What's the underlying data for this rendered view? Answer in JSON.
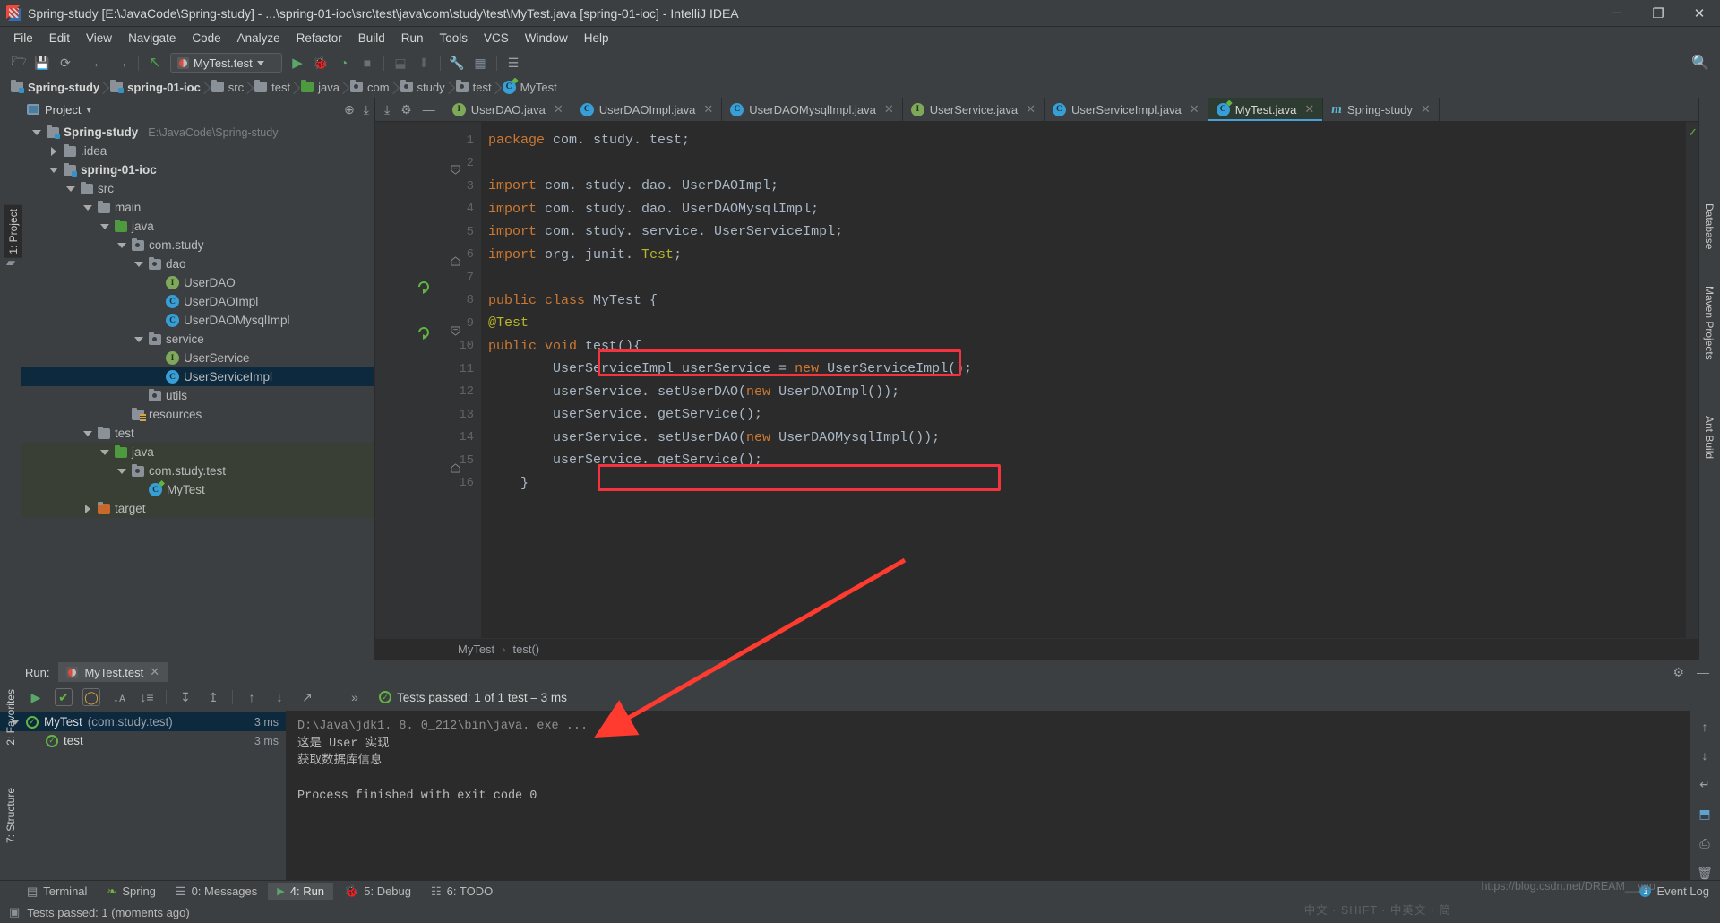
{
  "window": {
    "title": "Spring-study [E:\\JavaCode\\Spring-study] - ...\\spring-01-ioc\\src\\test\\java\\com\\study\\test\\MyTest.java [spring-01-ioc] - IntelliJ IDEA",
    "minimize": "─",
    "maximize": "❐",
    "close": "✕"
  },
  "menubar": [
    {
      "label": "File"
    },
    {
      "label": "Edit"
    },
    {
      "label": "View"
    },
    {
      "label": "Navigate"
    },
    {
      "label": "Code"
    },
    {
      "label": "Analyze"
    },
    {
      "label": "Refactor"
    },
    {
      "label": "Build"
    },
    {
      "label": "Run"
    },
    {
      "label": "Tools"
    },
    {
      "label": "VCS"
    },
    {
      "label": "Window"
    },
    {
      "label": "Help"
    }
  ],
  "toolbar": {
    "open_icon": "🗁",
    "save_icon": "💾",
    "sync_icon": "⟳",
    "back_icon": "←",
    "forward_icon": "→",
    "build_icon": "↖",
    "run_config": "MyTest.test",
    "run_icon": "▶",
    "debug_icon": "🐞",
    "coverage_icon": "◔",
    "stop_icon": "■",
    "stack_icon": "⬓",
    "profile_icon": "⬇",
    "settings_icon": "🔧",
    "project-structure_icon": "▦",
    "database_icon": "☰",
    "search_icon": "🔍"
  },
  "breadcrumb": [
    {
      "label": "Spring-study",
      "icon": "module-icon",
      "bold": true
    },
    {
      "label": "spring-01-ioc",
      "icon": "module-icon",
      "bold": true
    },
    {
      "label": "src",
      "icon": "folder-icon",
      "bold": false
    },
    {
      "label": "test",
      "icon": "folder-icon",
      "bold": false
    },
    {
      "label": "java",
      "icon": "source-folder-icon",
      "bold": false
    },
    {
      "label": "com",
      "icon": "package-icon",
      "bold": false
    },
    {
      "label": "study",
      "icon": "package-icon",
      "bold": false
    },
    {
      "label": "test",
      "icon": "package-icon",
      "bold": false
    },
    {
      "label": "MyTest",
      "icon": "test-class-icon",
      "bold": false
    }
  ],
  "left_strip": {
    "project_label": "1: Project",
    "favorites_label": "2: Favorites",
    "structure_label": "7: Structure"
  },
  "right_strip": {
    "database_label": "Database",
    "maven_label": "Maven Projects",
    "ant_label": "Ant Build"
  },
  "project_panel": {
    "title": "Project",
    "caret": "▾",
    "locate_icon": "⊕",
    "collapse_icon": "⤓",
    "settings_icon": "⚙",
    "hide_icon": "—",
    "tree": [
      {
        "label": "Spring-study",
        "path": "E:\\JavaCode\\Spring-study",
        "indent": 0,
        "twisty": "down",
        "icon": "module-icon",
        "bold": true,
        "state": "normal"
      },
      {
        "label": ".idea",
        "path": "",
        "indent": 1,
        "twisty": "right",
        "icon": "folder-icon",
        "bold": false,
        "state": "normal"
      },
      {
        "label": "spring-01-ioc",
        "path": "",
        "indent": 1,
        "twisty": "down",
        "icon": "module-icon",
        "bold": true,
        "state": "normal"
      },
      {
        "label": "src",
        "path": "",
        "indent": 2,
        "twisty": "down",
        "icon": "folder-icon",
        "bold": false,
        "state": "normal"
      },
      {
        "label": "main",
        "path": "",
        "indent": 3,
        "twisty": "down",
        "icon": "folder-icon",
        "bold": false,
        "state": "normal"
      },
      {
        "label": "java",
        "path": "",
        "indent": 4,
        "twisty": "down",
        "icon": "source-folder-icon",
        "bold": false,
        "state": "normal"
      },
      {
        "label": "com.study",
        "path": "",
        "indent": 5,
        "twisty": "down",
        "icon": "package-icon",
        "bold": false,
        "state": "normal"
      },
      {
        "label": "dao",
        "path": "",
        "indent": 6,
        "twisty": "down",
        "icon": "package-icon",
        "bold": false,
        "state": "normal"
      },
      {
        "label": "UserDAO",
        "path": "",
        "indent": 7,
        "twisty": "none",
        "icon": "interface-icon",
        "bold": false,
        "state": "normal"
      },
      {
        "label": "UserDAOImpl",
        "path": "",
        "indent": 7,
        "twisty": "none",
        "icon": "class-icon",
        "bold": false,
        "state": "normal"
      },
      {
        "label": "UserDAOMysqlImpl",
        "path": "",
        "indent": 7,
        "twisty": "none",
        "icon": "class-icon",
        "bold": false,
        "state": "normal"
      },
      {
        "label": "service",
        "path": "",
        "indent": 6,
        "twisty": "down",
        "icon": "package-icon",
        "bold": false,
        "state": "normal"
      },
      {
        "label": "UserService",
        "path": "",
        "indent": 7,
        "twisty": "none",
        "icon": "interface-icon",
        "bold": false,
        "state": "normal"
      },
      {
        "label": "UserServiceImpl",
        "path": "",
        "indent": 7,
        "twisty": "none",
        "icon": "class-icon",
        "bold": false,
        "state": "selected"
      },
      {
        "label": "utils",
        "path": "",
        "indent": 6,
        "twisty": "none",
        "icon": "package-icon",
        "bold": false,
        "state": "normal"
      },
      {
        "label": "resources",
        "path": "",
        "indent": 5,
        "twisty": "none",
        "icon": "resources-icon",
        "bold": false,
        "state": "normal"
      },
      {
        "label": "test",
        "path": "",
        "indent": 3,
        "twisty": "down",
        "icon": "folder-icon",
        "bold": false,
        "state": "normal"
      },
      {
        "label": "java",
        "path": "",
        "indent": 4,
        "twisty": "down",
        "icon": "test-source-folder-icon",
        "bold": false,
        "state": "green"
      },
      {
        "label": "com.study.test",
        "path": "",
        "indent": 5,
        "twisty": "down",
        "icon": "package-icon",
        "bold": false,
        "state": "green"
      },
      {
        "label": "MyTest",
        "path": "",
        "indent": 6,
        "twisty": "none",
        "icon": "test-class-icon",
        "bold": false,
        "state": "green"
      },
      {
        "label": "target",
        "path": "",
        "indent": 3,
        "twisty": "right",
        "icon": "target-folder-icon",
        "bold": false,
        "state": "green"
      }
    ]
  },
  "editor_tabs": [
    {
      "label": "UserDAO.java",
      "icon": "interface-icon",
      "close": "✕",
      "active": false
    },
    {
      "label": "UserDAOImpl.java",
      "icon": "class-icon",
      "close": "✕",
      "active": false
    },
    {
      "label": "UserDAOMysqlImpl.java",
      "icon": "class-icon",
      "close": "✕",
      "active": false
    },
    {
      "label": "UserService.java",
      "icon": "interface-icon",
      "close": "✕",
      "active": false
    },
    {
      "label": "UserServiceImpl.java",
      "icon": "class-icon",
      "close": "✕",
      "active": false
    },
    {
      "label": "MyTest.java",
      "icon": "test-class-icon",
      "close": "✕",
      "active": true
    },
    {
      "label": "Spring-study",
      "icon": "maven-icon",
      "close": "✕",
      "active": false
    }
  ],
  "editor": {
    "tab_left_icons": {
      "collapse_icon": "⤓",
      "settings_icon": "⚙",
      "hide_icon": "—"
    },
    "inspection_ok": "✓",
    "lines": [
      {
        "n": "1",
        "html": "<span class='kw'>package</span> com. study. test;"
      },
      {
        "n": "2",
        "html": ""
      },
      {
        "n": "3",
        "html": "<span class='kw'>import</span> com. study. dao. UserDAOImpl;"
      },
      {
        "n": "4",
        "html": "<span class='kw'>import</span> com. study. dao. UserDAOMysqlImpl;"
      },
      {
        "n": "5",
        "html": "<span class='kw'>import</span> com. study. service. UserServiceImpl;"
      },
      {
        "n": "6",
        "html": "<span class='kw'>import</span> org. junit. <span class='ann'>Test</span>;"
      },
      {
        "n": "7",
        "html": ""
      },
      {
        "n": "8",
        "html": "<span class='kw'>public class</span> MyTest {"
      },
      {
        "n": "9",
        "html": "    <span class='ann'>@Test</span>"
      },
      {
        "n": "10",
        "html": "    <span class='kw'>public void</span> test(){"
      },
      {
        "n": "11",
        "html": "        UserServiceImpl userService = <span class='kw'>new</span> UserServiceImpl();"
      },
      {
        "n": "12",
        "html": "        userService. setUserDAO(<span class='kw'>new</span> UserDAOImpl());"
      },
      {
        "n": "13",
        "html": "        userService. getService();"
      },
      {
        "n": "14",
        "html": "        userService. setUserDAO(<span class='kw'>new</span> UserDAOMysqlImpl());"
      },
      {
        "n": "15",
        "html": "        userService. getService();"
      },
      {
        "n": "16",
        "html": "    }"
      }
    ],
    "plain_lines": [
      "package com. study. test;",
      "",
      "import com. study. dao. UserDAOImpl;",
      "import com. study. dao. UserDAOMysqlImpl;",
      "import com. study. service. UserServiceImpl;",
      "import org. junit. Test;",
      "",
      "public class MyTest {",
      "    @Test",
      "    public void test(){",
      "        UserServiceImpl userService = new UserServiceImpl();",
      "        userService. setUserDAO(new UserDAOImpl());",
      "        userService. getService();",
      "        userService. setUserDAO(new UserDAOMysqlImpl());",
      "        userService. getService();",
      "    }"
    ],
    "status_crumbs": [
      "MyTest",
      "test()"
    ],
    "crumb_sep": "›",
    "highlight_color": "#f5333f",
    "annotation_arrow_color": "#ff3b30"
  },
  "run_window": {
    "label": "Run:",
    "tab": "MyTest.test",
    "tab_close": "✕",
    "settings_icon": "⚙",
    "hide_icon": "—",
    "toolbar": {
      "rerun_icon": "▶",
      "show-passed_icon": "✔",
      "show-ignored_icon": "◯",
      "sort-alpha_icon": "↓ᴀ",
      "sort-duration_icon": "↓≡",
      "expand-all_icon": "↧",
      "collapse-all_icon": "↥",
      "prev-failed_icon": "↑",
      "next-failed_icon": "↓",
      "export_icon": "↗",
      "more_icon": "»"
    },
    "status": "Tests passed: 1 of 1 test – 3 ms",
    "status_icon": "✓",
    "tests": [
      {
        "name": "MyTest",
        "package": "(com.study.test)",
        "time": "3 ms",
        "state": "selected",
        "indent": 0,
        "twisty": "down"
      },
      {
        "name": "test",
        "package": "",
        "time": "3 ms",
        "state": "normal",
        "indent": 1,
        "twisty": "none"
      }
    ],
    "console": [
      "D:\\Java\\jdk1. 8. 0_212\\bin\\java. exe ...",
      "这是 User 实现",
      "获取数据库信息",
      "",
      "Process finished with exit code 0"
    ],
    "side_icons": {
      "up_icon": "↑",
      "down_icon": "↓",
      "wrap_icon": "↵",
      "console-toggle_icon": "⬒",
      "print_icon": "⎙",
      "trash_icon": "🗑"
    }
  },
  "bottom_bar": {
    "items": [
      {
        "label": "Terminal",
        "icon": "terminal-icon",
        "active": false
      },
      {
        "label": "Spring",
        "icon": "spring-icon",
        "active": false
      },
      {
        "label": "0: Messages",
        "icon": "messages-icon",
        "active": false
      },
      {
        "label": "4: Run",
        "icon": "run-icon",
        "active": true
      },
      {
        "label": "5: Debug",
        "icon": "debug-icon",
        "active": false
      },
      {
        "label": "6: TODO",
        "icon": "todo-icon",
        "active": false
      }
    ],
    "event_log": "Event Log",
    "event_count": "1"
  },
  "statusbar": {
    "text": "Tests passed: 1 (moments ago)",
    "icon": "build-icon"
  },
  "watermarks": {
    "url": "https://blog.csdn.net/DREAM__yao",
    "ime": "中文 · SHIFT · 中英文 · 简"
  },
  "colors": {
    "accent": "#4a9fd8",
    "highlight": "#f5333f",
    "selection": "#0d293e",
    "test_green": "#62b543",
    "editor_bg": "#2b2b2b",
    "chrome_bg": "#3c3f41"
  }
}
